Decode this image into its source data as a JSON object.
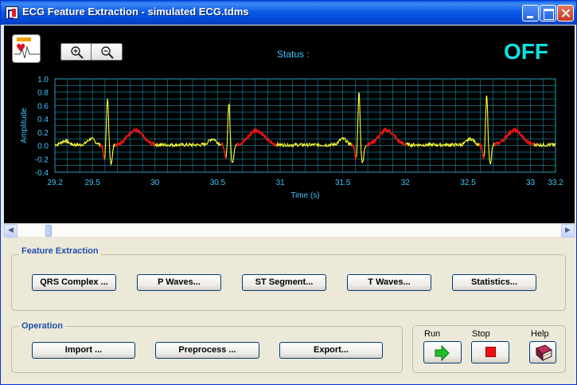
{
  "window": {
    "title": "ECG Feature Extraction - simulated ECG.tdms"
  },
  "status": {
    "label": "Status :",
    "value": "OFF"
  },
  "chart_data": {
    "type": "line",
    "xlabel": "Time (s)",
    "ylabel": "Amplitude",
    "xlim": [
      29.2,
      33.2
    ],
    "ylim": [
      -0.4,
      1.0
    ],
    "x_ticks": [
      "29.2",
      "29.5",
      "30",
      "30.5",
      "31",
      "31.5",
      "32",
      "32.5",
      "33",
      "33.2"
    ],
    "y_ticks": [
      "1.0",
      "0.8",
      "0.6",
      "0.4",
      "0.2",
      "0.0",
      "-0.2",
      "-0.4"
    ],
    "grid": true,
    "series": [
      {
        "color": "#ffff33",
        "r_peaks_x": [
          29.62,
          30.59,
          31.63,
          32.65
        ],
        "r_peak_values": [
          0.72,
          0.64,
          0.8,
          0.75
        ]
      },
      {
        "color": "#ee1111"
      }
    ]
  },
  "feature_extraction": {
    "title": "Feature Extraction",
    "buttons": [
      "QRS Complex ...",
      "P Waves...",
      "ST Segment...",
      "T Waves...",
      "Statistics..."
    ]
  },
  "operation": {
    "title": "Operation",
    "buttons": [
      "Import ...",
      "Preprocess ...",
      "Export..."
    ]
  },
  "controls": {
    "run_label": "Run",
    "stop_label": "Stop",
    "help_label": "Help"
  },
  "colors": {
    "accent": "#0054e3",
    "status_value": "#10e0e0",
    "grid": "#1a8fa8",
    "trace": "#ffff33",
    "highlight": "#ee1111"
  },
  "icons": [
    "app-icon",
    "zoom-in-icon",
    "zoom-out-icon",
    "run-arrow-icon",
    "stop-icon",
    "help-book-icon"
  ]
}
